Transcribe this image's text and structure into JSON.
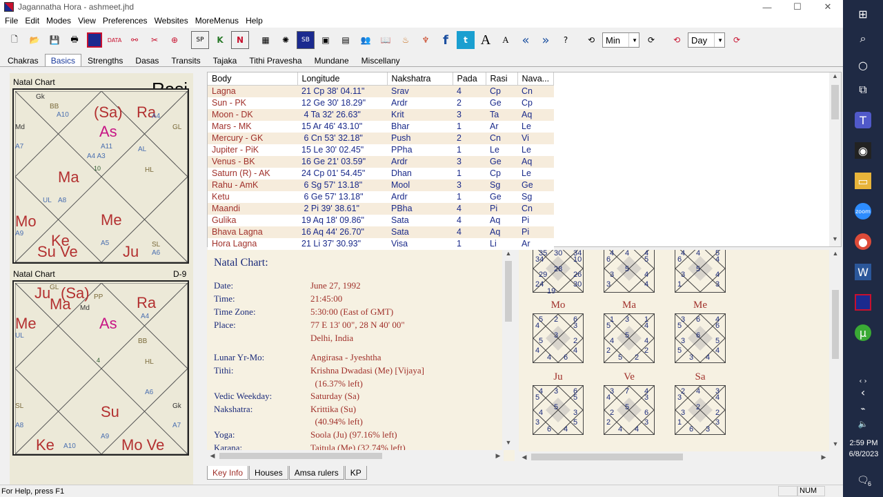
{
  "window": {
    "title": "Jagannatha Hora - ashmeet.jhd",
    "minimize": "—",
    "maximize": "☐",
    "close": "✕"
  },
  "menu": [
    "File",
    "Edit",
    "Modes",
    "View",
    "Preferences",
    "Websites",
    "MoreMenus",
    "Help"
  ],
  "toolbar": {
    "icons": [
      "new-file-icon",
      "open-file-icon",
      "save-icon",
      "print-icon",
      "chart-icon",
      "data-icon",
      "transit-icon",
      "tools-icon",
      "wheel-icon",
      "sp-kh-icon",
      "k-icon",
      "n-icon",
      "grid-icon",
      "star-icon",
      "sb-icon",
      "frame-icon",
      "table-icon",
      "people-icon",
      "book-icon",
      "dance-icon",
      "fire-icon",
      "facebook-icon",
      "twitter-icon",
      "font-larger-icon",
      "font-smaller-icon",
      "back-icon",
      "forward-icon",
      "help-icon"
    ],
    "step_unit": "Min",
    "step_unit2": "Day"
  },
  "tabs": [
    "Chakras",
    "Basics",
    "Strengths",
    "Dasas",
    "Transits",
    "Tajaka",
    "Tithi Pravesha",
    "Mundane",
    "Miscellany"
  ],
  "active_tab": "Basics",
  "chart1": {
    "label": "Natal Chart",
    "title": "Rasi"
  },
  "chart2": {
    "label": "Natal Chart",
    "division": "D-9"
  },
  "table": {
    "headers": [
      "Body",
      "Longitude",
      "Nakshatra",
      "Pada",
      "Rasi",
      "Nava..."
    ],
    "rows": [
      [
        "Lagna",
        "21 Cp 38' 04.11\"",
        "Srav",
        "4",
        "Cp",
        "Cn"
      ],
      [
        "Sun - PK",
        "12 Ge 30' 18.29\"",
        "Ardr",
        "2",
        "Ge",
        "Cp"
      ],
      [
        "Moon - DK",
        " 4 Ta 32' 26.63\"",
        "Krit",
        "3",
        "Ta",
        "Aq"
      ],
      [
        "Mars - MK",
        "15 Ar 46' 43.10\"",
        "Bhar",
        "1",
        "Ar",
        "Le"
      ],
      [
        "Mercury - GK",
        " 6 Cn 53' 32.18\"",
        "Push",
        "2",
        "Cn",
        "Vi"
      ],
      [
        "Jupiter - PiK",
        "15 Le 30' 02.45\"",
        "PPha",
        "1",
        "Le",
        "Le"
      ],
      [
        "Venus - BK",
        "16 Ge 21' 03.59\"",
        "Ardr",
        "3",
        "Ge",
        "Aq"
      ],
      [
        "Saturn (R) - AK",
        "24 Cp 01' 54.45\"",
        "Dhan",
        "1",
        "Cp",
        "Le"
      ],
      [
        "Rahu - AmK",
        " 6 Sg 57' 13.18\"",
        "Mool",
        "3",
        "Sg",
        "Ge"
      ],
      [
        "Ketu",
        " 6 Ge 57' 13.18\"",
        "Ardr",
        "1",
        "Ge",
        "Sg"
      ],
      [
        "Maandi",
        " 2 Pi 39' 38.61\"",
        "PBha",
        "4",
        "Pi",
        "Cn"
      ],
      [
        "Gulika",
        "19 Aq 18' 09.86\"",
        "Sata",
        "4",
        "Aq",
        "Pi"
      ],
      [
        "Bhava Lagna",
        "16 Aq 44' 26.70\"",
        "Sata",
        "4",
        "Aq",
        "Pi"
      ],
      [
        "Hora Lagna",
        "21 Li 37' 30.93\"",
        "Visa",
        "1",
        "Li",
        "Ar"
      ]
    ]
  },
  "info": {
    "heading": "Natal Chart:",
    "rows": [
      {
        "k": "Date:",
        "v": "June 27, 1992"
      },
      {
        "k": "Time:",
        "v": "21:45:00"
      },
      {
        "k": "Time Zone:",
        "v": "5:30:00 (East of GMT)"
      },
      {
        "k": "Place:",
        "v": "77 E 13' 00\", 28 N 40' 00\""
      },
      {
        "k": "",
        "v": "Delhi, India"
      },
      {
        "k": "Lunar Yr-Mo:",
        "v": "Angirasa - Jyeshtha"
      },
      {
        "k": "Tithi:",
        "v": "Krishna Dwadasi (Me) [Vijaya]"
      },
      {
        "k": "",
        "v": "  (16.37% left)"
      },
      {
        "k": "Vedic Weekday:",
        "v": "Saturday (Sa)"
      },
      {
        "k": "Nakshatra:",
        "v": "Krittika (Su)"
      },
      {
        "k": "",
        "v": "  (40.94% left)"
      },
      {
        "k": "Yoga:",
        "v": "Soola (Ju) (97.16% left)"
      },
      {
        "k": "Karana:",
        "v": "Taitula (Me) (32.74% left)"
      }
    ]
  },
  "bottom_tabs": [
    "Key Info",
    "Houses",
    "Amsa rulers",
    "KP"
  ],
  "varga": {
    "titles": [
      "Mo",
      "Ma",
      "Me",
      "Ju",
      "Ve",
      "Sa"
    ],
    "top": [
      [
        "35",
        "30",
        "34",
        "34",
        "10",
        "28",
        "29",
        "26",
        "24",
        "30",
        "19"
      ],
      [
        "4",
        "4",
        "4",
        "6",
        "5",
        "5",
        "3",
        "4",
        "3",
        "4"
      ],
      [
        "4",
        "4",
        "5",
        "6",
        "4",
        "5",
        "3",
        "4",
        "1",
        "3"
      ]
    ],
    "grids": [
      [
        "5",
        "2",
        "6",
        "4",
        "3",
        "3",
        "5",
        "2",
        "4",
        "4",
        "4",
        "6"
      ],
      [
        "1",
        "3",
        "1",
        "5",
        "4",
        "5",
        "4",
        "4",
        "2",
        "2",
        "5",
        "2"
      ],
      [
        "3",
        "6",
        "4",
        "5",
        "6",
        "6",
        "3",
        "5",
        "5",
        "4",
        "3",
        "4"
      ],
      [
        "4",
        "3",
        "6",
        "5",
        "5",
        "5",
        "4",
        "3",
        "3",
        "5",
        "6",
        "4"
      ],
      [
        "3",
        "7",
        "4",
        "4",
        "3",
        "5",
        "2",
        "6",
        "2",
        "3",
        "4",
        "4"
      ],
      [
        "2",
        "4",
        "3",
        "3",
        "4",
        "2",
        "3",
        "2",
        "1",
        "3",
        "6",
        "3"
      ]
    ]
  },
  "status": {
    "help": "For Help, press F1",
    "num": "NUM"
  },
  "taskbar": {
    "time": "2:59 PM",
    "date": "6/8/2023",
    "notif": "6"
  }
}
